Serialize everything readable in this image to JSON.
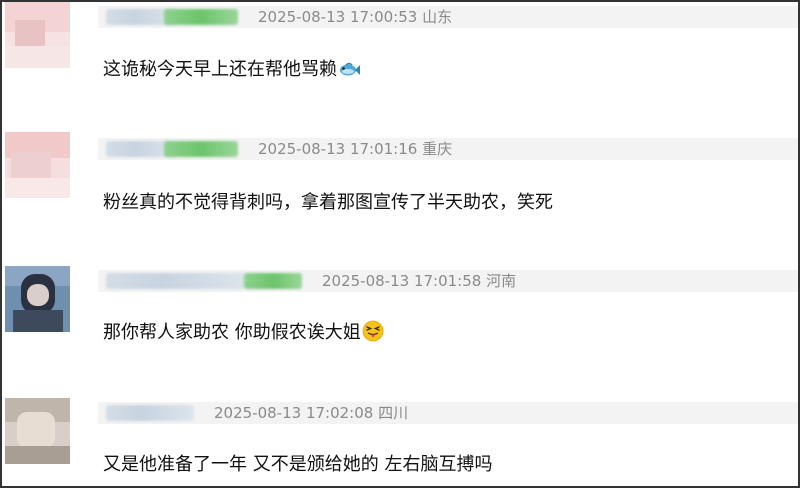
{
  "comments": [
    {
      "timestamp": "2025-08-13 17:00:53",
      "location": "山东",
      "text": "这诡秘今天早上还在帮他骂赖",
      "emoji": "fish-emoji"
    },
    {
      "timestamp": "2025-08-13 17:01:16",
      "location": "重庆",
      "text": "粉丝真的不觉得背刺吗，拿着那图宣传了半天助农，笑死"
    },
    {
      "timestamp": "2025-08-13 17:01:58",
      "location": "河南",
      "text": "那你帮人家助农 你助假农诶大姐",
      "emoji": "tongue-out-face-emoji"
    },
    {
      "timestamp": "2025-08-13 17:02:08",
      "location": "四川",
      "text": "又是他准备了一年 又不是颁给她的 左右脑互搏吗"
    }
  ],
  "colors": {
    "meta_bar": "#f3f3f3",
    "timestamp_text": "#8a8a8a",
    "comment_text": "#111111",
    "name_blur_gray": "#c7d3df",
    "name_blur_green": "#6cc46c",
    "frame_border": "#333333"
  }
}
